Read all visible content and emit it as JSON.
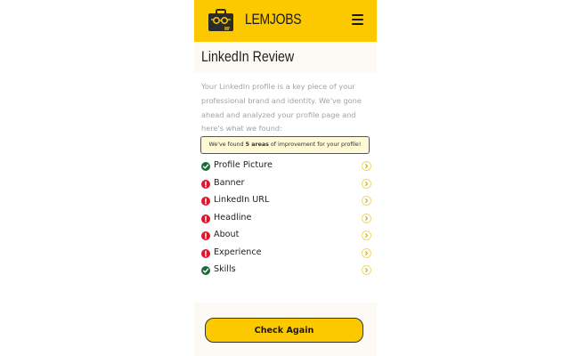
{
  "header": {
    "brand": "LEMJOBS",
    "logo_icon": "briefcase-icon",
    "menu_icon": "hamburger-menu-icon",
    "bg_color": "#fcc800"
  },
  "page": {
    "title": "LinkedIn Review",
    "intro": "Your LinkedIn profile is a key piece of your professional brand and identity. We've gone ahead and analyzed your profile page and here's what we found:",
    "notice": {
      "prefix": "We've found ",
      "count": "5 areas",
      "suffix": " of improvement for your profile!"
    }
  },
  "review_items": [
    {
      "label": "Profile Picture",
      "status": "ok"
    },
    {
      "label": "Banner",
      "status": "bad"
    },
    {
      "label": "LinkedIn URL",
      "status": "bad"
    },
    {
      "label": "Headline",
      "status": "bad"
    },
    {
      "label": "About",
      "status": "bad"
    },
    {
      "label": "Experience",
      "status": "bad"
    },
    {
      "label": "Skills",
      "status": "ok"
    }
  ],
  "status_colors": {
    "ok": "#1d6b3b",
    "bad": "#e0142b"
  },
  "footer": {
    "button_label": "Check Again"
  }
}
